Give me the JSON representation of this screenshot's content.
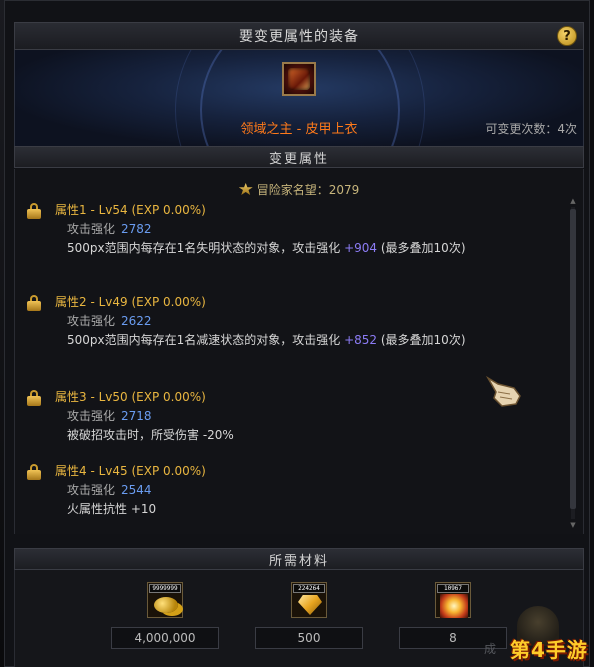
{
  "window": {
    "title": "要变更属性的装备",
    "help_label": "?"
  },
  "equipment": {
    "name": "领域之主 - 皮甲上衣",
    "remaining_changes": "可变更次数：4次"
  },
  "change_section": {
    "header": "变更属性",
    "reputation": "冒险家名望：2079",
    "properties": [
      {
        "title": "属性1 - Lv54 (EXP 0.00%)",
        "stat_label": "攻击强化",
        "stat_value": "2782",
        "desc_prefix": "500px范围内每存在1名失明状态的对象，攻击强化 ",
        "desc_bonus": "+904",
        "desc_suffix": " (最多叠加10次)"
      },
      {
        "title": "属性2 - Lv49 (EXP 0.00%)",
        "stat_label": "攻击强化",
        "stat_value": "2622",
        "desc_prefix": "500px范围内每存在1名减速状态的对象，攻击强化 ",
        "desc_bonus": "+852",
        "desc_suffix": " (最多叠加10次)"
      },
      {
        "title": "属性3 - Lv50 (EXP 0.00%)",
        "stat_label": "攻击强化",
        "stat_value": "2718",
        "desc_prefix": "被破招攻击时，所受伤害 -20%",
        "desc_bonus": "",
        "desc_suffix": ""
      },
      {
        "title": "属性4 - Lv45 (EXP 0.00%)",
        "stat_label": "攻击强化",
        "stat_value": "2544",
        "desc_prefix": "火属性抗性 +10",
        "desc_bonus": "",
        "desc_suffix": ""
      }
    ]
  },
  "materials": {
    "header": "所需材料",
    "items": [
      {
        "icon": "gold-coins-icon",
        "badge": "9999999",
        "count": "4,000,000"
      },
      {
        "icon": "gold-gem-icon",
        "badge": "224264",
        "count": "500"
      },
      {
        "icon": "fire-burst-icon",
        "badge": "10967",
        "count": "8"
      }
    ]
  },
  "footer": {
    "faded_label": "成",
    "watermark": "第4手游"
  },
  "colors": {
    "property_title": "#e9b640",
    "stat_value": "#6a9cf0",
    "bonus": "#8c7cf5",
    "item_name": "#ff7a1a"
  }
}
